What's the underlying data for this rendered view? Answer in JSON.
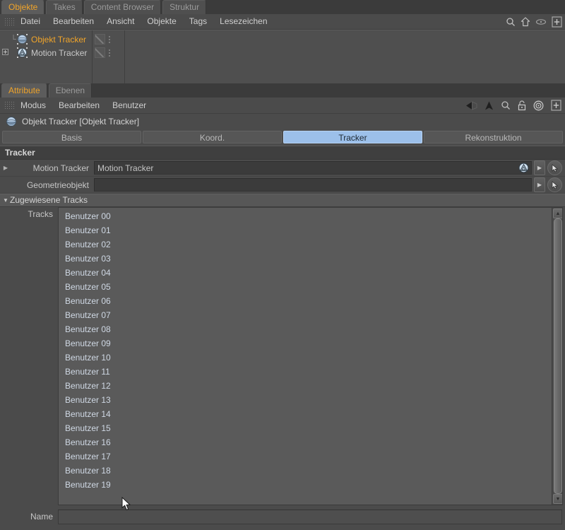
{
  "object_manager": {
    "tabs": [
      {
        "label": "Objekte",
        "active": true
      },
      {
        "label": "Takes",
        "active": false
      },
      {
        "label": "Content Browser",
        "active": false
      },
      {
        "label": "Struktur",
        "active": false
      }
    ],
    "menu": [
      "Datei",
      "Bearbeiten",
      "Ansicht",
      "Objekte",
      "Tags",
      "Lesezeichen"
    ],
    "icons": [
      "search-icon",
      "home-icon",
      "eye-icon",
      "plus-icon"
    ],
    "tree": [
      {
        "name": "Objekt Tracker",
        "icon": "sphere-icon",
        "selected": true,
        "expandable": false
      },
      {
        "name": "Motion Tracker",
        "icon": "motion-tracker-icon",
        "selected": false,
        "expandable": true
      }
    ]
  },
  "attribute_manager": {
    "tabs": [
      {
        "label": "Attribute",
        "active": true
      },
      {
        "label": "Ebenen",
        "active": false
      }
    ],
    "menu": [
      "Modus",
      "Bearbeiten",
      "Benutzer"
    ],
    "icons": [
      "back-arrow-icon",
      "forward-arrow-icon",
      "up-arrow-icon",
      "search-icon",
      "lock-icon",
      "target-icon",
      "plus-icon"
    ],
    "title": "Objekt Tracker [Objekt Tracker]",
    "title_icon": "sphere-icon",
    "property_tabs": [
      {
        "label": "Basis",
        "active": false
      },
      {
        "label": "Koord.",
        "active": false
      },
      {
        "label": "Tracker",
        "active": true
      },
      {
        "label": "Rekonstruktion",
        "active": false
      }
    ],
    "section_title": "Tracker",
    "fields": [
      {
        "label": "Motion Tracker",
        "value": "Motion Tracker",
        "has_chip": true,
        "has_disclosure": true
      },
      {
        "label": "Geometrieobjekt",
        "value": "",
        "has_chip": false,
        "has_disclosure": false
      }
    ],
    "group": {
      "label": "Zugewiesene Tracks",
      "expanded": true,
      "list_label": "Tracks",
      "tracks": [
        "Benutzer 00",
        "Benutzer 01",
        "Benutzer 02",
        "Benutzer 03",
        "Benutzer 04",
        "Benutzer 05",
        "Benutzer 06",
        "Benutzer 07",
        "Benutzer 08",
        "Benutzer 09",
        "Benutzer 10",
        "Benutzer 11",
        "Benutzer 12",
        "Benutzer 13",
        "Benutzer 14",
        "Benutzer 15",
        "Benutzer 16",
        "Benutzer 17",
        "Benutzer 18",
        "Benutzer 19"
      ]
    },
    "name_field": {
      "label": "Name",
      "value": ""
    }
  },
  "colors": {
    "accent_orange": "#f0a42a",
    "tab_active_blue": "#9cc0ea",
    "panel_bg": "#4b4b4b",
    "list_bg": "#5a5a5a",
    "track_text": "#cfd8e4"
  }
}
